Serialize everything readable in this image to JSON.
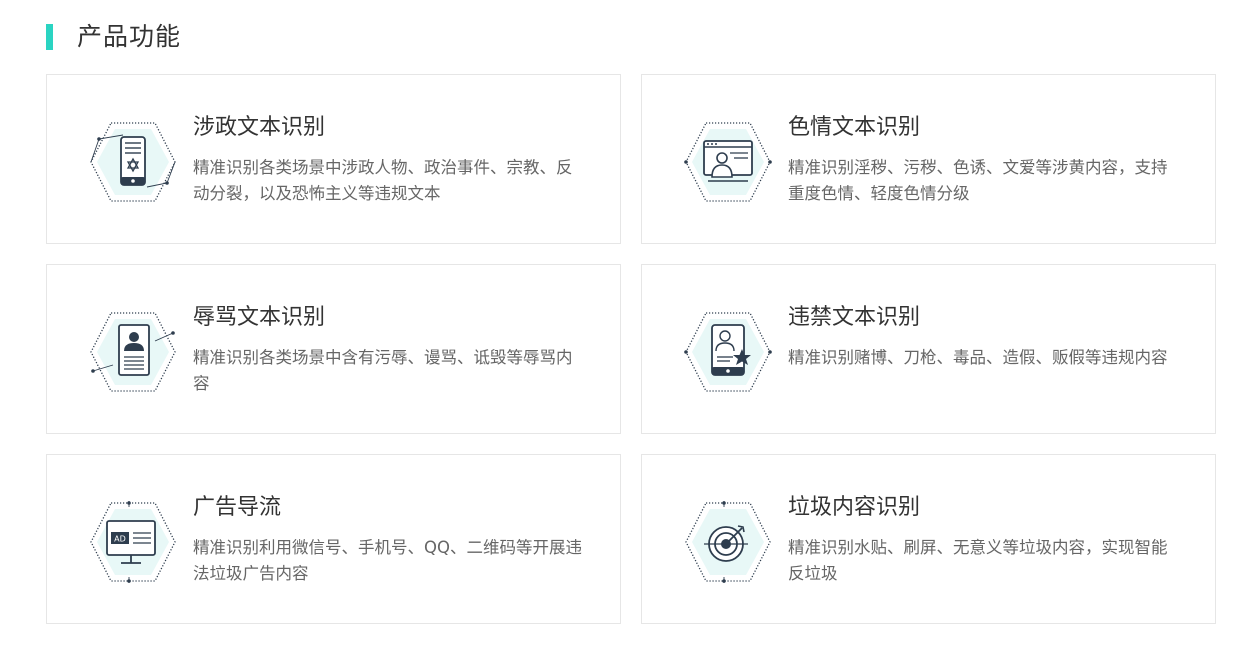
{
  "theme": {
    "accent": "#2ad4c2",
    "icon_stroke": "#2e3d4e",
    "icon_fill": "#e8f8f7"
  },
  "section": {
    "title": "产品功能"
  },
  "cards": [
    {
      "title": "涉政文本识别",
      "desc": "精准识别各类场景中涉政人物、政治事件、宗教、反动分裂，以及恐怖主义等违规文本",
      "icon": "phone-star-of-david-icon"
    },
    {
      "title": "色情文本识别",
      "desc": "精准识别淫秽、污秽、色诱、文爱等涉黄内容，支持重度色情、轻度色情分级",
      "icon": "monitor-person-icon"
    },
    {
      "title": "辱骂文本识别",
      "desc": "精准识别各类场景中含有污辱、谩骂、诋毁等辱骂内容",
      "icon": "id-card-person-icon"
    },
    {
      "title": "违禁文本识别",
      "desc": "精准识别赌博、刀枪、毒品、造假、贩假等违规内容",
      "icon": "tablet-star-icon"
    },
    {
      "title": "广告导流",
      "desc": "精准识别利用微信号、手机号、QQ、二维码等开展违法垃圾广告内容",
      "icon": "ad-board-icon"
    },
    {
      "title": "垃圾内容识别",
      "desc": "精准识别水贴、刷屏、无意义等垃圾内容，实现智能反垃圾",
      "icon": "target-icon"
    }
  ]
}
